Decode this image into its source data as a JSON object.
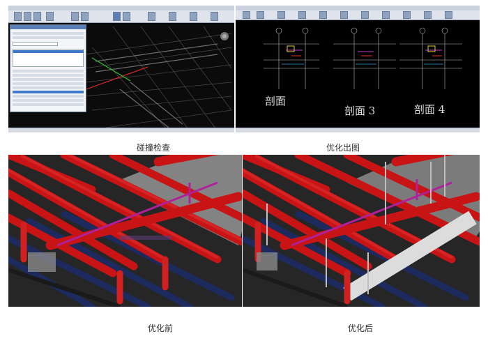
{
  "captions": {
    "clash_check": "碰撞检查",
    "optimized_drawing": "优化出图",
    "before_optimization": "优化前",
    "after_optimization": "优化后"
  },
  "drawing_labels": {
    "section_1": "剖面",
    "section_3": "剖面 3",
    "section_4": "剖面 4"
  },
  "colors": {
    "pipe_red": "#c81414",
    "duct_navy": "#1c2a5e",
    "pipe_magenta": "#b0209a",
    "cad_background": "#000000"
  }
}
